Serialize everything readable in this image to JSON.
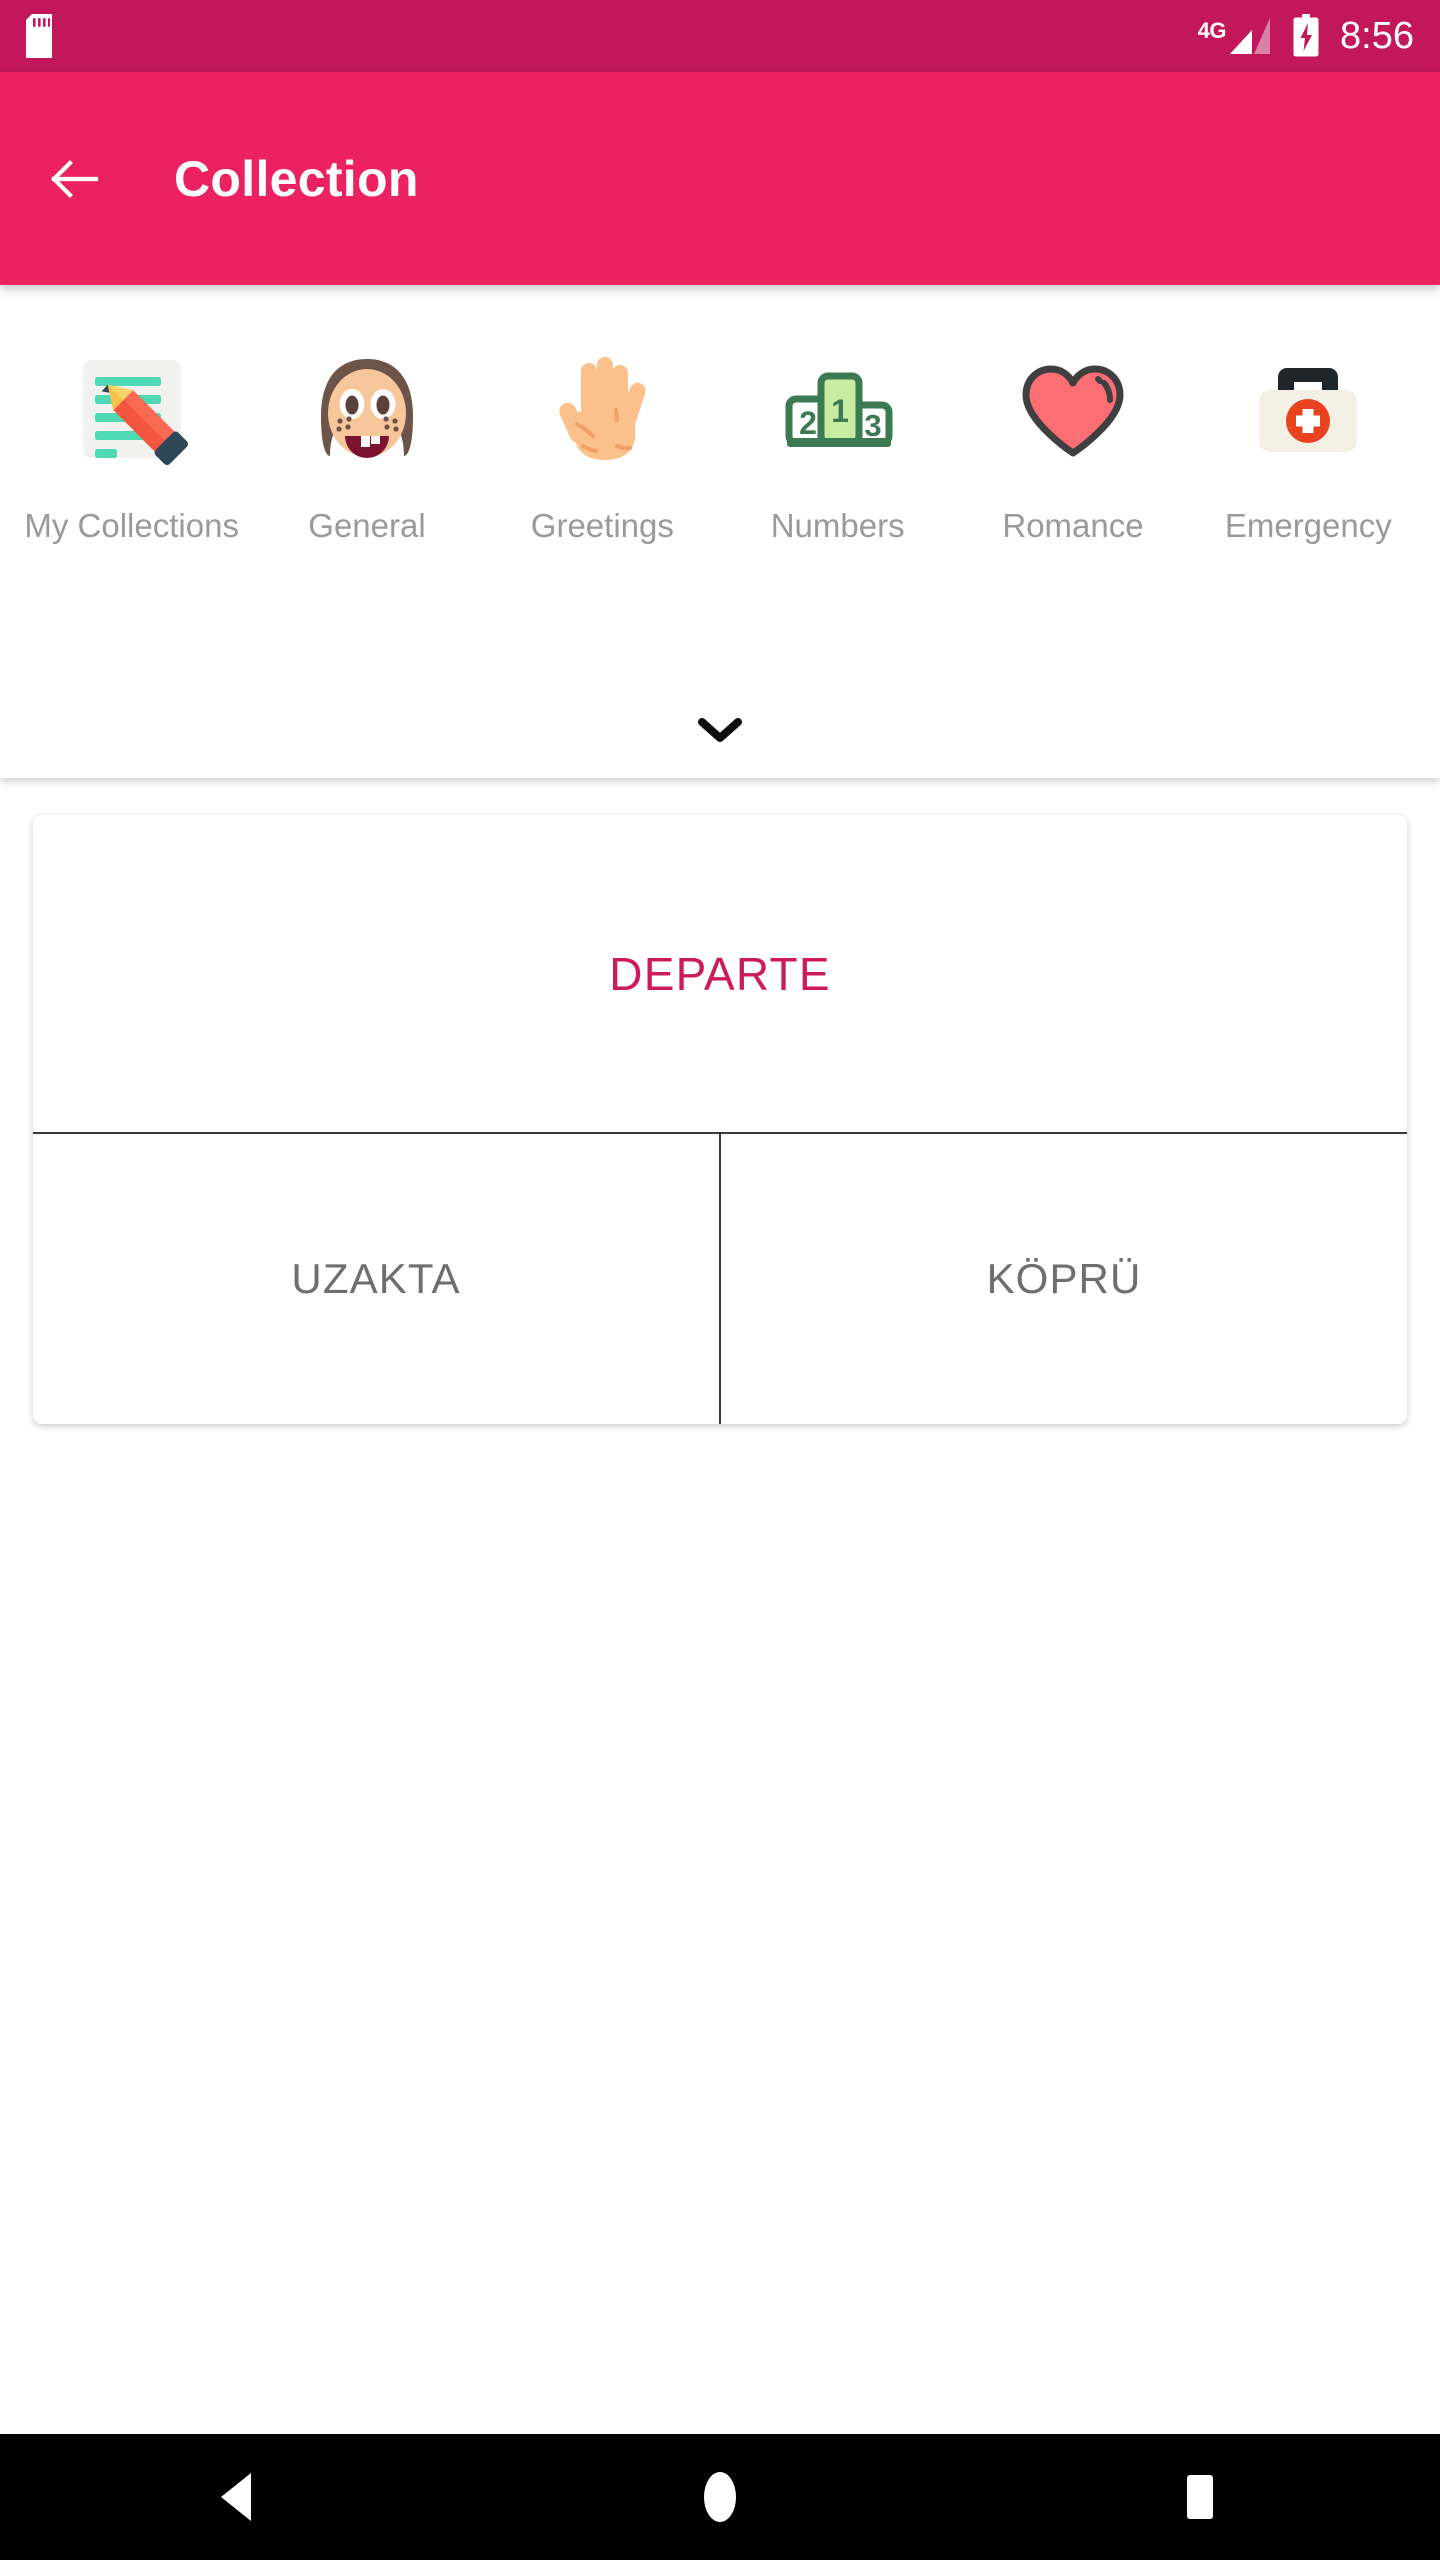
{
  "status_bar": {
    "sd_card_icon": "sd-card-icon",
    "network_label": "4G",
    "signal_icon": "signal-bars-icon",
    "battery_icon": "battery-charging-icon",
    "time": "8:56",
    "background_color": "#C2185B"
  },
  "app_bar": {
    "back_icon": "back-arrow-icon",
    "title": "Collection",
    "background_color": "#EC2260",
    "text_color": "#FFFFFF"
  },
  "categories": {
    "items": [
      {
        "label": "My Collections",
        "icon": "note-pencil-icon"
      },
      {
        "label": "General",
        "icon": "girl-face-icon"
      },
      {
        "label": "Greetings",
        "icon": "raised-hand-icon"
      },
      {
        "label": "Numbers",
        "icon": "podium-123-icon"
      },
      {
        "label": "Romance",
        "icon": "heart-icon"
      },
      {
        "label": "Emergency",
        "icon": "first-aid-kit-icon"
      }
    ],
    "expand_icon": "chevron-down-icon",
    "label_color": "#9A9A9A"
  },
  "word_card": {
    "main_word": "DEPARTE",
    "main_word_color": "#CC1B5C",
    "options": [
      {
        "label": "UZAKTA"
      },
      {
        "label": "KÖPRÜ"
      }
    ],
    "option_color": "#6E6E6E"
  },
  "nav_bar": {
    "back_icon": "nav-back-triangle-icon",
    "home_icon": "nav-home-circle-icon",
    "recents_icon": "nav-recents-square-icon",
    "background_color": "#000000"
  }
}
